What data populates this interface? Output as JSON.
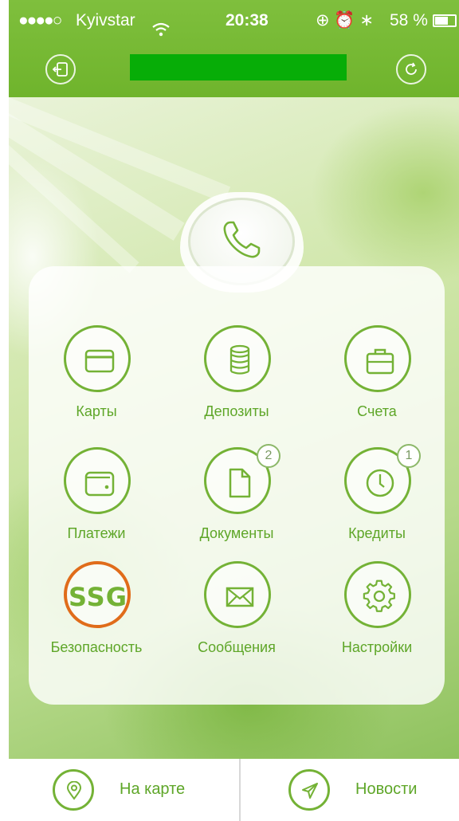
{
  "status_bar": {
    "signal_dots": "●●●●○",
    "carrier": "Kyivstar",
    "time": "20:38",
    "status_icons": "⊕ ⏰ ∗",
    "battery_percent": "58 %"
  },
  "header": {
    "title": ""
  },
  "tiles": [
    {
      "label": "Карты",
      "icon": "card-icon"
    },
    {
      "label": "Депозиты",
      "icon": "coins-icon"
    },
    {
      "label": "Счета",
      "icon": "briefcase-icon"
    },
    {
      "label": "Платежи",
      "icon": "wallet-icon"
    },
    {
      "label": "Документы",
      "icon": "document-icon",
      "badge": "2"
    },
    {
      "label": "Кредиты",
      "icon": "clock-icon",
      "badge": "1"
    },
    {
      "label": "Безопасность",
      "icon": "ssg-logo",
      "logo_text": "SSG"
    },
    {
      "label": "Сообщения",
      "icon": "envelope-icon"
    },
    {
      "label": "Настройки",
      "icon": "gear-icon"
    }
  ],
  "bottom_bar": {
    "map_label": "На карте",
    "news_label": "Новости"
  },
  "colors": {
    "accent": "#74b236",
    "header": "#6fb42c",
    "highlight_ring": "#e06c1a",
    "title_bar": "#07ad07"
  }
}
